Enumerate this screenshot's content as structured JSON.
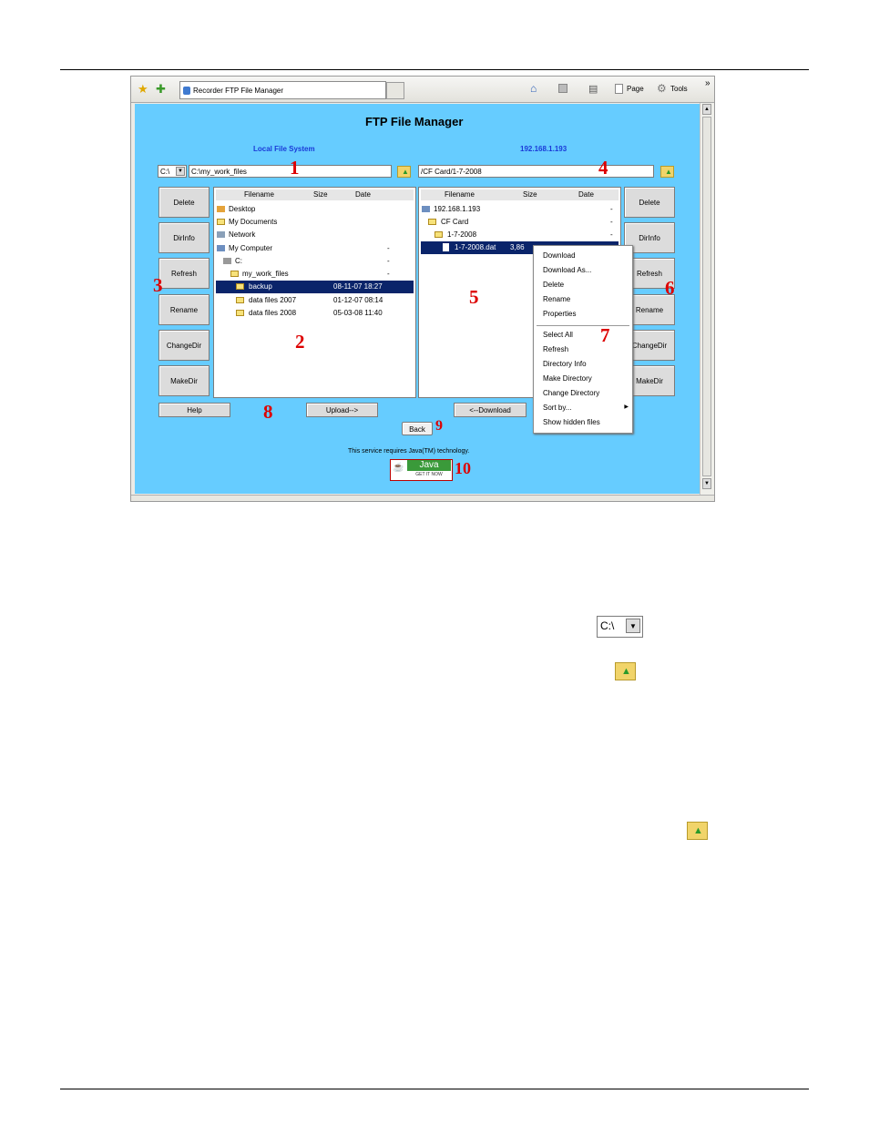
{
  "browser": {
    "tab_title": "Recorder FTP File Manager",
    "page_label": "Page",
    "tools_label": "Tools",
    "chevron": "»"
  },
  "app": {
    "title": "FTP File Manager",
    "local_label": "Local File System",
    "remote_label": "192.168.1.193",
    "drive_value": "C:\\",
    "local_path": "C:\\my_work_files",
    "remote_path": "/CF Card/1-7-2008",
    "columns": [
      "Filename",
      "Size",
      "Date"
    ],
    "local_buttons": [
      "Delete",
      "DirInfo",
      "Refresh",
      "Rename",
      "ChangeDir",
      "MakeDir"
    ],
    "remote_buttons": [
      "Delete",
      "DirInfo",
      "Refresh",
      "Rename",
      "ChangeDir",
      "MakeDir"
    ],
    "local_files": [
      {
        "name": "Desktop",
        "size": "",
        "date": ""
      },
      {
        "name": "My Documents",
        "size": "",
        "date": ""
      },
      {
        "name": "Network",
        "size": "",
        "date": ""
      },
      {
        "name": "My Computer",
        "size": "",
        "date": "-"
      },
      {
        "name": "C:",
        "size": "",
        "date": "-"
      },
      {
        "name": "my_work_files",
        "size": "",
        "date": "-"
      },
      {
        "name": "backup",
        "size": "",
        "date": "08-11-07 18:27"
      },
      {
        "name": "data files 2007",
        "size": "",
        "date": "01-12-07 08:14"
      },
      {
        "name": "data files 2008",
        "size": "",
        "date": "05-03-08 11:40"
      }
    ],
    "remote_files": [
      {
        "name": "192.168.1.193",
        "size": "",
        "date": "-"
      },
      {
        "name": "CF Card",
        "size": "",
        "date": "-"
      },
      {
        "name": "1-7-2008",
        "size": "",
        "date": "-"
      },
      {
        "name": "1-7-2008.dat",
        "size": "3,86",
        "date": ""
      }
    ],
    "context_menu": [
      "Download",
      "Download As...",
      "Delete",
      "Rename",
      "Properties",
      "Select All",
      "Refresh",
      "Directory Info",
      "Make Directory",
      "Change Directory",
      "Sort by...",
      "Show hidden files"
    ],
    "help_label": "Help",
    "upload_label": "Upload-->",
    "download_label": "<--Download",
    "back_label": "Back",
    "java_notice": "This service requires Java(TM) technology.",
    "java_badge": "Java",
    "java_sub": "GET IT NOW"
  },
  "callouts": [
    "1",
    "2",
    "3",
    "4",
    "5",
    "6",
    "7",
    "8",
    "9",
    "10"
  ],
  "samples": {
    "drive_value": "C:\\"
  }
}
